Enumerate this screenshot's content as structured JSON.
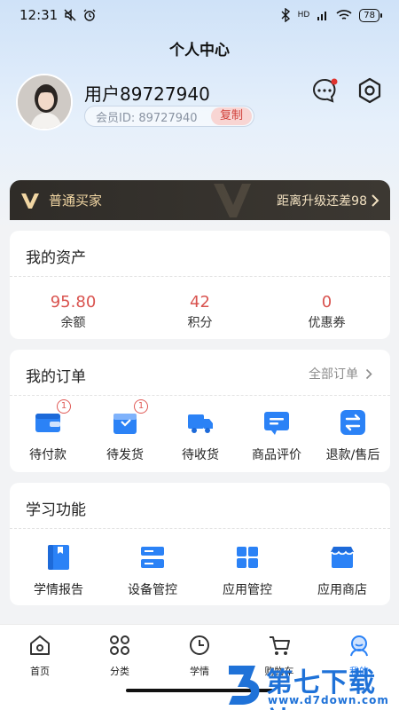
{
  "status_bar": {
    "time": "12:31",
    "battery": "78",
    "network": "HD"
  },
  "header": {
    "title": "个人中心"
  },
  "profile": {
    "username": "用户89727940",
    "member_id_label": "会员ID: 89727940",
    "copy_label": "复制"
  },
  "vip": {
    "level_label": "普通买家",
    "upgrade_text": "距离升级还差98"
  },
  "assets": {
    "title": "我的资产",
    "items": [
      {
        "value": "95.80",
        "label": "余额"
      },
      {
        "value": "42",
        "label": "积分"
      },
      {
        "value": "0",
        "label": "优惠券"
      }
    ]
  },
  "orders": {
    "title": "我的订单",
    "all_label": "全部订单",
    "items": [
      {
        "label": "待付款",
        "icon": "wallet-icon",
        "badge": "1"
      },
      {
        "label": "待发货",
        "icon": "package-icon",
        "badge": "1"
      },
      {
        "label": "待收货",
        "icon": "truck-icon"
      },
      {
        "label": "商品评价",
        "icon": "comment-icon"
      },
      {
        "label": "退款/售后",
        "icon": "exchange-icon"
      }
    ]
  },
  "study": {
    "title": "学习功能",
    "items": [
      {
        "label": "学情报告",
        "icon": "book-icon"
      },
      {
        "label": "设备管控",
        "icon": "server-icon"
      },
      {
        "label": "应用管控",
        "icon": "grid-icon"
      },
      {
        "label": "应用商店",
        "icon": "store-icon"
      }
    ]
  },
  "tabs": [
    {
      "label": "首页",
      "icon": "home-icon"
    },
    {
      "label": "分类",
      "icon": "category-icon"
    },
    {
      "label": "学情",
      "icon": "clock-icon"
    },
    {
      "label": "购物车",
      "icon": "cart-icon"
    },
    {
      "label": "我的",
      "icon": "user-icon",
      "active": true
    }
  ],
  "watermark": {
    "title": "第七下载站",
    "url": "www.d7down.com"
  },
  "colors": {
    "accent": "#2b82f6",
    "price_red": "#d9534f",
    "vip_gold": "#f1d6a3"
  }
}
